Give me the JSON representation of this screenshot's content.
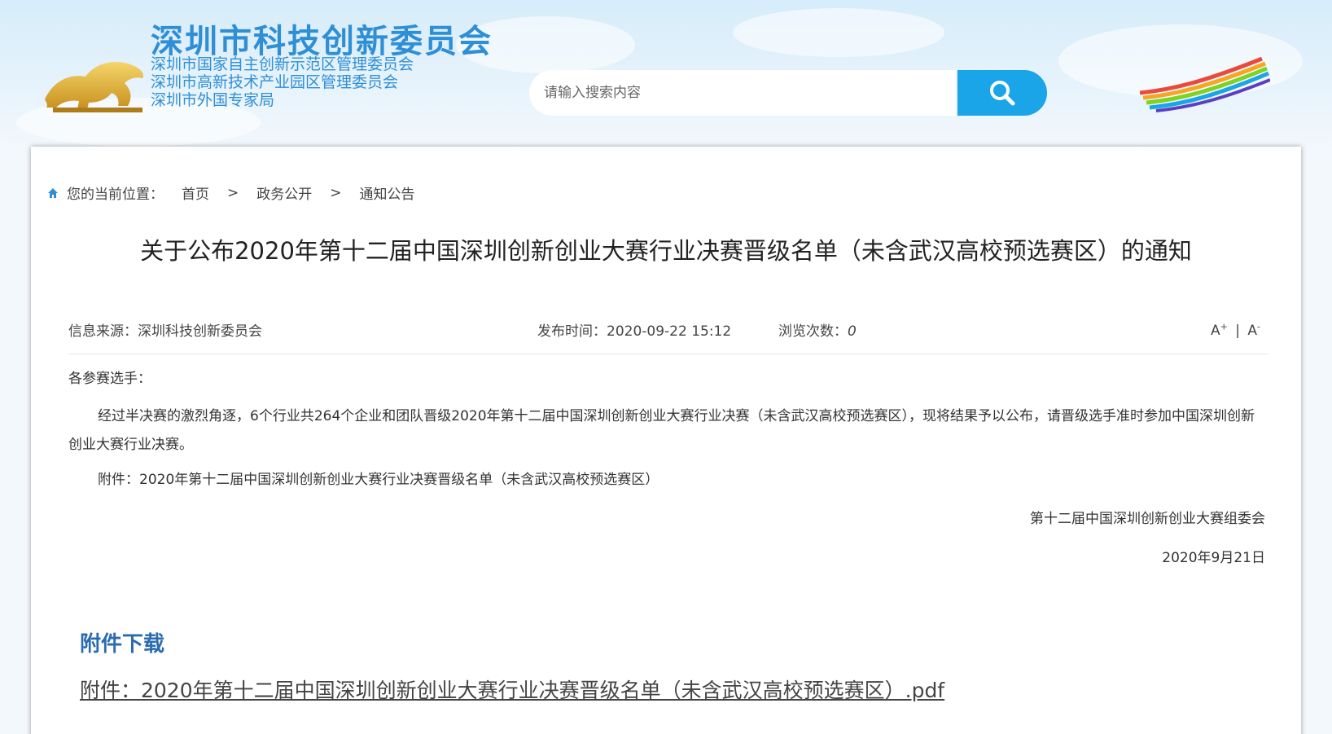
{
  "header": {
    "site_title": "深圳市科技创新委员会",
    "subtitles": [
      "深圳市国家自主创新示范区管理委员会",
      "深圳市高新技术产业园区管理委员会",
      "深圳市外国专家局"
    ],
    "search_placeholder": "请输入搜索内容",
    "search_button_icon": "search-icon",
    "accent_color": "#1aa5e8",
    "title_color": "#2f8fd6"
  },
  "breadcrumb": {
    "icon": "home-icon",
    "label": "您的当前位置：",
    "items": [
      "首页",
      "政务公开",
      "通知公告"
    ],
    "separator": ">"
  },
  "article": {
    "title": "关于公布2020年第十二届中国深圳创新创业大赛行业决赛晋级名单（未含武汉高校预选赛区）的通知",
    "source_label": "信息来源：",
    "source": "深圳科技创新委员会",
    "time_label": "发布时间：",
    "time": "2020-09-22 15:12",
    "views_label": "浏览次数：",
    "views": "0",
    "font_increase": "A",
    "font_decrease": "A",
    "font_divider": "|",
    "greeting": "各参赛选手：",
    "paragraph": "经过半决赛的激烈角逐，6个行业共264个企业和团队晋级2020年第十二届中国深圳创新创业大赛行业决赛（未含武汉高校预选赛区），现将结果予以公布，请晋级选手准时参加中国深圳创新创业大赛行业决赛。",
    "attachment_note": "附件：2020年第十二届中国深圳创新创业大赛行业决赛晋级名单（未含武汉高校预选赛区）",
    "organizer": "第十二届中国深圳创新创业大赛组委会",
    "date": "2020年9月21日"
  },
  "downloads": {
    "heading": "附件下载",
    "link": "附件：2020年第十二届中国深圳创新创业大赛行业决赛晋级名单（未含武汉高校预选赛区）.pdf",
    "heading_color": "#2b6cb0"
  }
}
